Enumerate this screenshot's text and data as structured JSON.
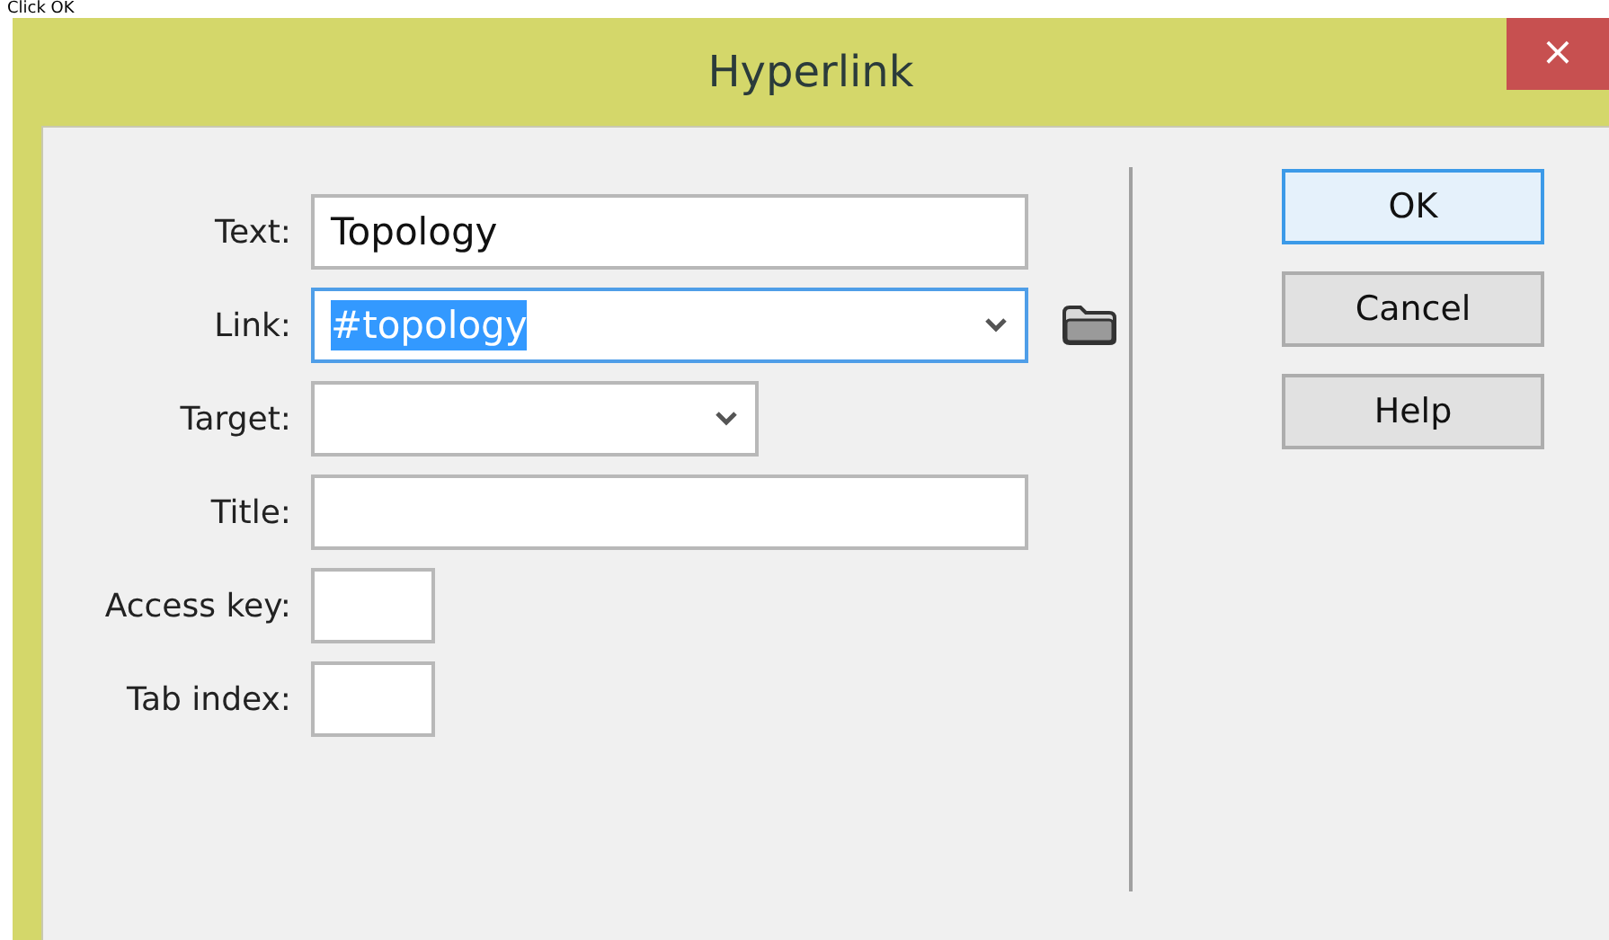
{
  "caption": "Click OK",
  "window": {
    "title": "Hyperlink",
    "close": "×"
  },
  "fields": [
    {
      "kind": "text",
      "label": "Text:",
      "value": "Topology",
      "focused": false
    },
    {
      "kind": "combo",
      "label": "Link:",
      "value": "#topology",
      "focused": true,
      "selected_text": true,
      "browse": true
    },
    {
      "kind": "select",
      "label": "Target:",
      "focused": false
    },
    {
      "kind": "text",
      "label": "Title:",
      "focused": false
    },
    {
      "kind": "small",
      "label": "Access key:",
      "focused": false
    },
    {
      "kind": "small",
      "label": "Tab index:",
      "focused": false
    }
  ],
  "buttons": [
    {
      "label": "OK",
      "default": true
    },
    {
      "label": "Cancel",
      "default": false
    },
    {
      "label": "Help",
      "default": false
    }
  ]
}
